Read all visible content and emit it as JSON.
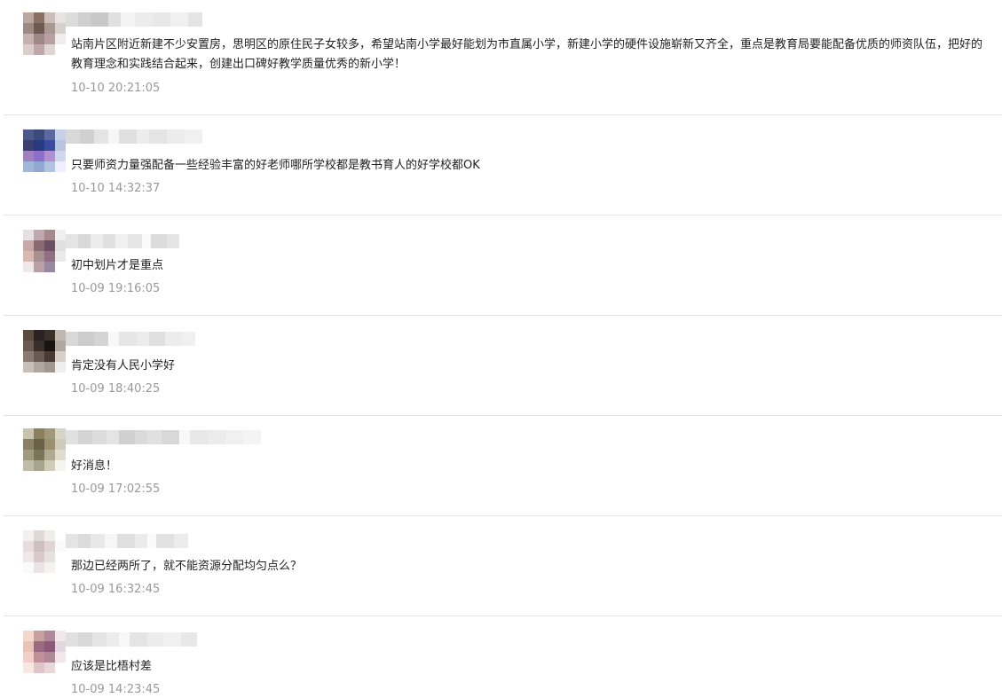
{
  "colors": {
    "text": "#1f1f1f",
    "time": "#999999",
    "divider": "#e4e4e4"
  },
  "comments": [
    {
      "text": "站南片区附近新建不少安置房，思明区的原住民子女较多，希望站南小学最好能划为市直属小学，新建小学的硬件设施崭新又齐全，重点是教育局要能配备优质的师资队伍，把好的教育理念和实践结合起来，创建出口碑好教学质量优秀的新小学！",
      "time": "10-10 20:21:05"
    },
    {
      "text": "只要师资力量强配备一些经验丰富的好老师哪所学校都是教书育人的好学校都OK",
      "time": "10-10 14:32:37"
    },
    {
      "text": "初中划片才是重点",
      "time": "10-09 19:16:05"
    },
    {
      "text": "肯定没有人民小学好",
      "time": "10-09 18:40:25"
    },
    {
      "text": "好消息！",
      "time": "10-09 17:02:55"
    },
    {
      "text": "那边已经两所了，就不能资源分配均匀点么？",
      "time": "10-09 16:32:45"
    },
    {
      "text": "应该是比梧村差",
      "time": "10-09 14:23:45"
    }
  ]
}
